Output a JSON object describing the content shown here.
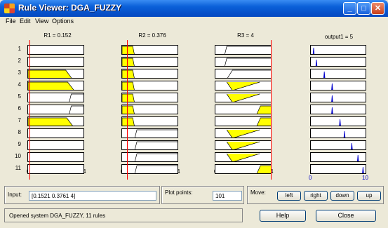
{
  "window": {
    "title": "Rule Viewer: DGA_FUZZY",
    "minimize_glyph": "_",
    "maximize_glyph": "□",
    "close_glyph": "✕"
  },
  "menu": [
    "File",
    "Edit",
    "View",
    "Options"
  ],
  "columns": [
    {
      "title": "R1 = 0.152",
      "axis_min": "0",
      "axis_max": "4",
      "value": 0.152
    },
    {
      "title": "R2 = 0.376",
      "axis_min": "0",
      "axis_max": "4",
      "value": 0.376
    },
    {
      "title": "R3 = 4",
      "axis_min": "0",
      "axis_max": "4",
      "value": 4
    }
  ],
  "output": {
    "title": "output1 = 5",
    "axis_min": "0",
    "axis_max": "10",
    "value": 5
  },
  "rows": [
    "1",
    "2",
    "3",
    "4",
    "5",
    "6",
    "7",
    "8",
    "9",
    "10",
    "11"
  ],
  "controls": {
    "input_label": "Input:",
    "input_value": "[0.1521 0.3761 4]",
    "plot_points_label": "Plot points:",
    "plot_points_value": "101",
    "move_label": "Move:",
    "left": "left",
    "right": "right",
    "down": "down",
    "up": "up",
    "help": "Help",
    "close": "Close"
  },
  "status": "Opened system DGA_FUZZY, 11 rules",
  "colors": {
    "fill": "#ffff00",
    "marker": "#ff0000",
    "output_line": "#0000cc"
  }
}
